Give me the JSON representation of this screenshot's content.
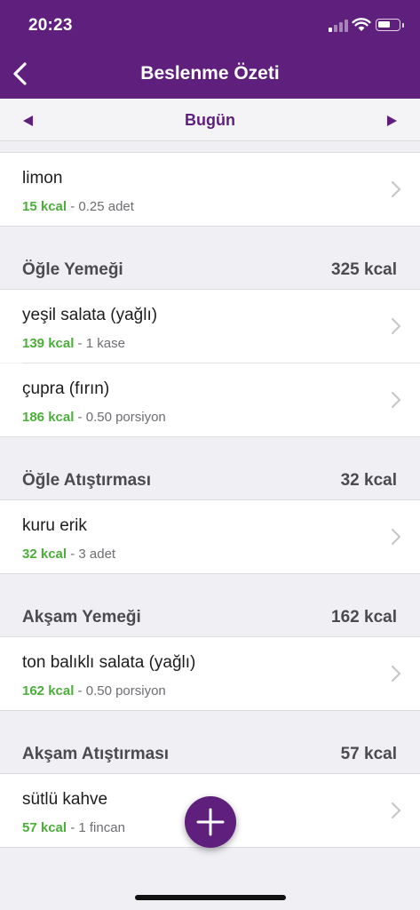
{
  "status_bar": {
    "time": "20:23"
  },
  "header": {
    "title": "Beslenme Özeti",
    "back_icon": "chevron-left-icon"
  },
  "date_nav": {
    "label": "Bugün",
    "prev_icon": "triangle-left-icon",
    "next_icon": "triangle-right-icon"
  },
  "items": [
    {
      "name": "limon",
      "kcal": "15 kcal",
      "amount": " - 0.25 adet"
    },
    {
      "name": "yeşil salata (yağlı)",
      "kcal": "139 kcal",
      "amount": " - 1 kase"
    },
    {
      "name": "çupra (fırın)",
      "kcal": "186 kcal",
      "amount": " - 0.50 porsiyon"
    },
    {
      "name": "kuru erik",
      "kcal": "32 kcal",
      "amount": " - 3 adet"
    },
    {
      "name": "ton balıklı salata (yağlı)",
      "kcal": "162 kcal",
      "amount": " - 0.50 porsiyon"
    },
    {
      "name": "sütlü kahve",
      "kcal": "57 kcal",
      "amount": " - 1 fincan"
    }
  ],
  "sections": [
    {
      "label": "Öğle Yemeği",
      "total": "325 kcal"
    },
    {
      "label": "Öğle Atıştırması",
      "total": "32 kcal"
    },
    {
      "label": "Akşam Yemeği",
      "total": "162 kcal"
    },
    {
      "label": "Akşam Atıştırması",
      "total": "57 kcal"
    }
  ],
  "fab": {
    "icon": "plus-icon"
  },
  "colors": {
    "brand": "#5e1f7d",
    "kcal": "#4cae3a",
    "background": "#efeff4"
  }
}
